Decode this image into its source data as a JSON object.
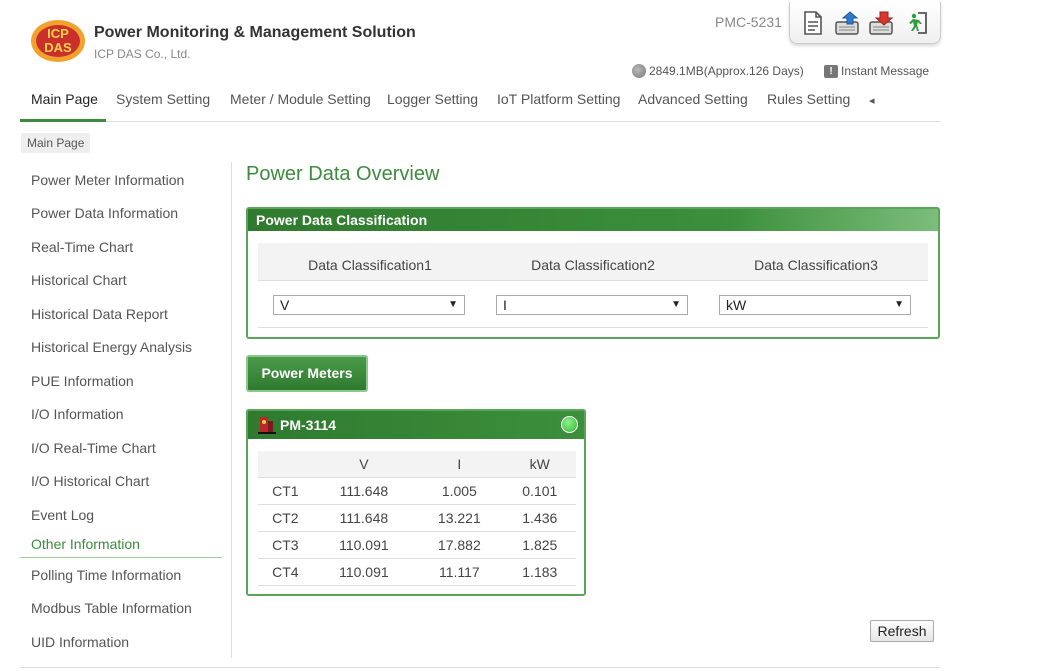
{
  "brand": {
    "title": "Power Monitoring & Management Solution",
    "subtitle": "ICP DAS Co., Ltd.",
    "logo_text": "ICP DAS"
  },
  "header": {
    "model": "PMC-5231",
    "storage": "2849.1MB(Approx.126 Days)",
    "instant_message": "Instant Message",
    "toolbar_icons": [
      "document-icon",
      "upload-icon",
      "download-icon",
      "logout-icon"
    ]
  },
  "nav": {
    "items": [
      "Main Page",
      "System Setting",
      "Meter / Module Setting",
      "Logger Setting",
      "IoT Platform Setting",
      "Advanced Setting",
      "Rules Setting"
    ],
    "more": "◂"
  },
  "breadcrumb": "Main Page",
  "sidebar": {
    "items": [
      "Power Meter Information",
      "Power Data Information",
      "Real-Time Chart",
      "Historical Chart",
      "Historical Data Report",
      "Historical Energy Analysis",
      "PUE Information",
      "I/O Information",
      "I/O Real-Time Chart",
      "I/O Historical Chart",
      "Event Log",
      "Other Information",
      "Polling Time Information",
      "Modbus Table Information",
      "UID Information"
    ],
    "active": "Other Information"
  },
  "main": {
    "title": "Power Data Overview",
    "classification": {
      "title": "Power Data Classification",
      "labels": [
        "Data Classification1",
        "Data Classification2",
        "Data Classification3"
      ],
      "values": [
        "V",
        "I",
        "kW"
      ]
    },
    "power_meters_button": "Power Meters",
    "meter": {
      "name": "PM-3114",
      "status_color": "#2eb82e",
      "columns": [
        "",
        "V",
        "I",
        "kW"
      ],
      "rows": [
        [
          "CT1",
          "111.648",
          "1.005",
          "0.101"
        ],
        [
          "CT2",
          "111.648",
          "13.221",
          "1.436"
        ],
        [
          "CT3",
          "110.091",
          "17.882",
          "1.825"
        ],
        [
          "CT4",
          "110.091",
          "11.117",
          "1.183"
        ]
      ]
    },
    "refresh_label": "Refresh"
  },
  "colors": {
    "accent": "#3d8b3d",
    "panel_header": "#2f7a2f"
  }
}
